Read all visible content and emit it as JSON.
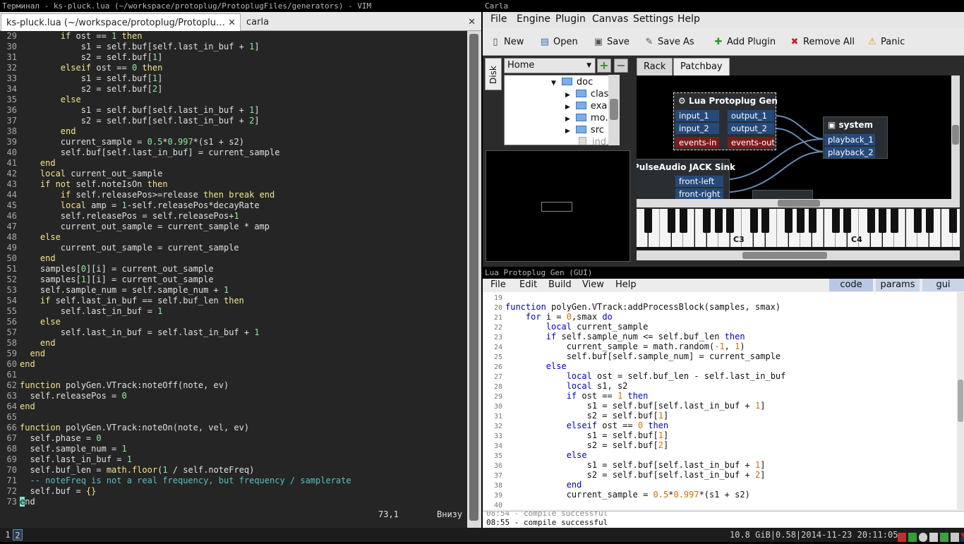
{
  "vim": {
    "title": "Терминал - ks-pluck.lua (~/workspace/protoplug/ProtoplugFiles/generators) - VIM",
    "tabs": [
      {
        "label": "ks-pluck.lua (~/workspace/protoplug/Protoplu…",
        "close": "✕"
      },
      {
        "label": "carla",
        "close": "✕"
      }
    ],
    "status_pos": "73,1",
    "status_scroll": "Внизу"
  },
  "carla": {
    "title": "Carla",
    "menu": [
      "File",
      "Engine",
      "Plugin",
      "Canvas",
      "Settings",
      "Help"
    ],
    "toolbar": [
      {
        "label": "New",
        "icon": "new-file-icon"
      },
      {
        "label": "Open",
        "icon": "open-folder-icon"
      },
      {
        "label": "Save",
        "icon": "save-icon"
      },
      {
        "label": "Save As",
        "icon": "save-as-icon"
      },
      {
        "label": "Add Plugin",
        "icon": "plus-icon"
      },
      {
        "label": "Remove All",
        "icon": "remove-icon"
      },
      {
        "label": "Panic",
        "icon": "warning-icon"
      }
    ],
    "disk_tab": "Disk",
    "home_combo": "Home",
    "tree": [
      {
        "label": "doc",
        "type": "folder",
        "expanded": true
      },
      {
        "label": "clas…",
        "type": "folder"
      },
      {
        "label": "exa…",
        "type": "folder"
      },
      {
        "label": "mo…",
        "type": "folder"
      },
      {
        "label": "src",
        "type": "folder"
      },
      {
        "label": "ind…",
        "type": "file"
      }
    ],
    "tabs": [
      "Rack",
      "Patchbay"
    ],
    "active_tab": "Patchbay",
    "patchbay": {
      "node_lua": {
        "title": "Lua Protoplug Gen",
        "inputs": [
          "input_1",
          "input_2",
          "events-in"
        ],
        "outputs": [
          "output_1",
          "output_2",
          "events-out"
        ]
      },
      "node_system": {
        "title": "system",
        "ports": [
          "playback_1",
          "playback_2"
        ]
      },
      "node_pulse": {
        "title": "PulseAudio JACK Sink",
        "ports": [
          "front-left",
          "front-right"
        ]
      }
    },
    "piano_labels": [
      "C3",
      "C4"
    ]
  },
  "protoplug": {
    "title": "Lua Protoplug Gen (GUI)",
    "menu": [
      "File",
      "Edit",
      "Build",
      "View",
      "Help"
    ],
    "tabs": [
      "code",
      "params",
      "gui"
    ],
    "log": [
      "08:54 - compile successful",
      "08:55 - compile successful"
    ]
  },
  "taskbar": {
    "workspaces": [
      "1",
      "2"
    ],
    "status": "10.8 GiB|0.58|2014-11-23 20:11:05"
  }
}
